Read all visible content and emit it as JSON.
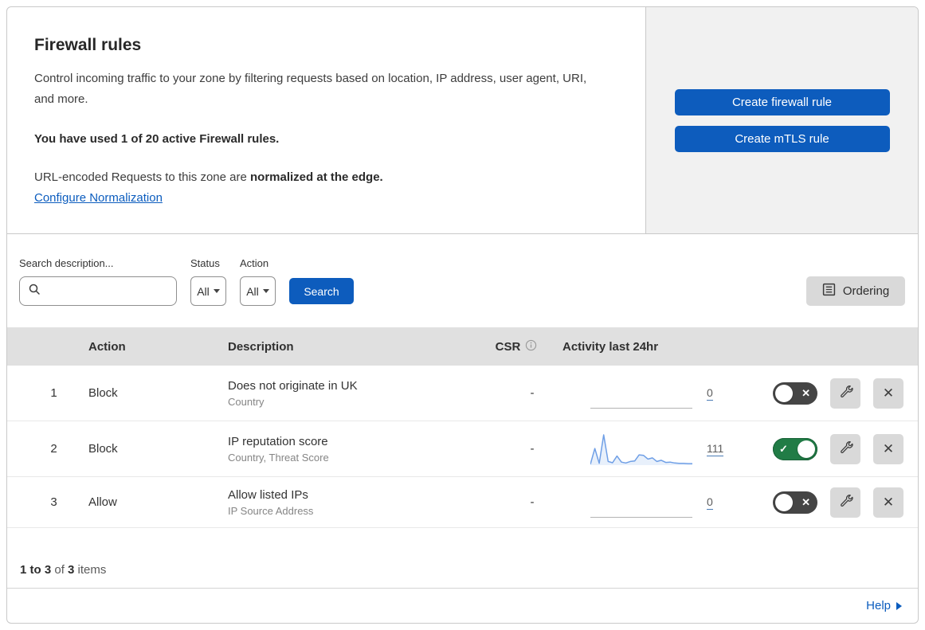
{
  "header": {
    "title": "Firewall rules",
    "description": "Control incoming traffic to your zone by filtering requests based on location, IP address, user agent, URI, and more.",
    "usage": "You have used 1 of 20 active Firewall rules.",
    "normalization_prefix": "URL-encoded Requests to this zone are ",
    "normalization_bold": "normalized at the edge.",
    "normalization_link": "Configure Normalization",
    "create_firewall_rule_label": "Create firewall rule",
    "create_mtls_rule_label": "Create mTLS rule"
  },
  "filters": {
    "search_label": "Search description...",
    "status_label": "Status",
    "status_value": "All",
    "action_label": "Action",
    "action_value": "All",
    "search_button_label": "Search",
    "ordering_button_label": "Ordering"
  },
  "table": {
    "columns": {
      "action": "Action",
      "description": "Description",
      "csr": "CSR",
      "activity": "Activity last 24hr"
    },
    "rows": [
      {
        "number": "1",
        "action": "Block",
        "title": "Does not originate in UK",
        "fields": "Country",
        "csr": "-",
        "count": "0",
        "enabled": false,
        "sparkline": null
      },
      {
        "number": "2",
        "action": "Block",
        "title": "IP reputation score",
        "fields": "Country, Threat Score",
        "csr": "-",
        "count": "111",
        "enabled": true,
        "sparkline": [
          3,
          55,
          6,
          100,
          12,
          8,
          30,
          10,
          7,
          12,
          14,
          34,
          32,
          20,
          24,
          12,
          16,
          9,
          10,
          7,
          6,
          6,
          5,
          5
        ]
      },
      {
        "number": "3",
        "action": "Allow",
        "title": "Allow listed IPs",
        "fields": "IP Source Address",
        "csr": "-",
        "count": "0",
        "enabled": false,
        "sparkline": null
      }
    ]
  },
  "footer": {
    "range": "1 to 3",
    "of": " of ",
    "total": "3",
    "items": " items",
    "help_label": "Help"
  },
  "colors": {
    "accent_blue": "#0d5cbd",
    "link_blue": "#0b5cbe",
    "toggle_on_green": "#217c46",
    "toggle_off_gray": "#454545",
    "table_header_bg": "#e0e0e0",
    "panel_bg": "#f1f1f1",
    "border": "#c9c9c9",
    "sparkline_blue": "#6f9fe6"
  }
}
